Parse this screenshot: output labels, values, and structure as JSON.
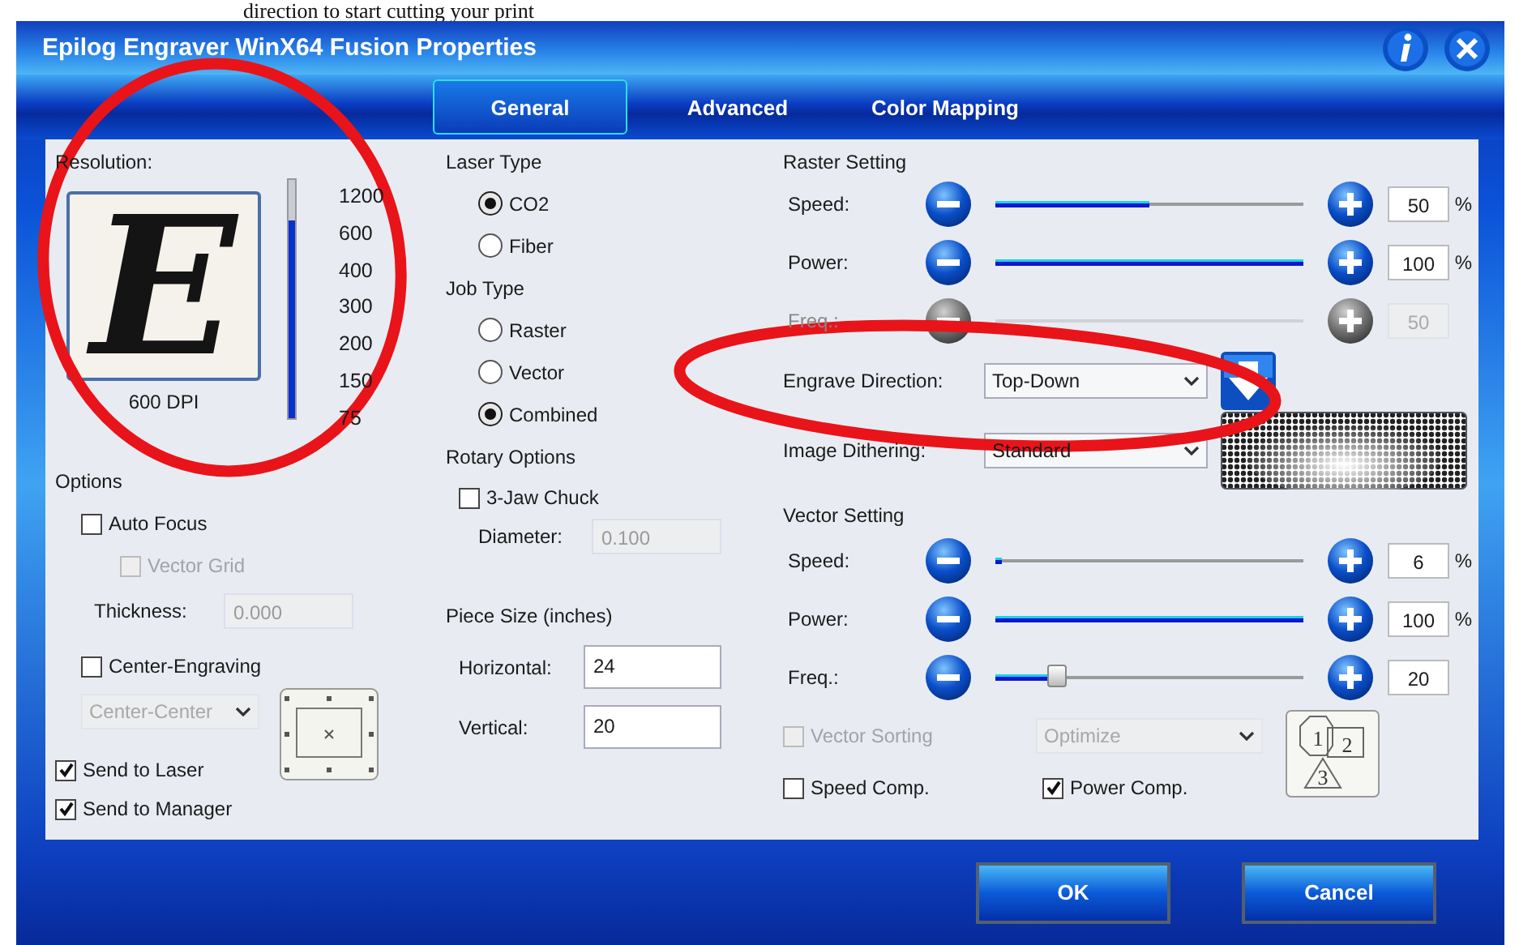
{
  "caption": "direction to start cutting your print",
  "window": {
    "title": "Epilog Engraver WinX64 Fusion Properties"
  },
  "tabs": [
    {
      "label": "General",
      "selected": true
    },
    {
      "label": "Advanced",
      "selected": false
    },
    {
      "label": "Color Mapping",
      "selected": false
    }
  ],
  "resolution": {
    "label": "Resolution:",
    "preview_letter": "E",
    "reading": "600 DPI",
    "level": 0.83,
    "ticks": [
      "1200",
      "600",
      "400",
      "300",
      "200",
      "150",
      "75"
    ]
  },
  "options": {
    "title": "Options",
    "auto_focus": {
      "label": "Auto Focus",
      "checked": false,
      "disabled": false
    },
    "vector_grid": {
      "label": "Vector Grid",
      "checked": false,
      "disabled": true
    },
    "thickness": {
      "label": "Thickness:",
      "value": "0.000",
      "disabled": true
    },
    "center_engraving": {
      "label": "Center-Engraving",
      "checked": false,
      "disabled": false
    },
    "center_position": {
      "value": "Center-Center",
      "disabled": true
    },
    "send_to_laser": {
      "label": "Send to Laser",
      "checked": true,
      "disabled": false
    },
    "send_to_manager": {
      "label": "Send to Manager",
      "checked": true,
      "disabled": false
    }
  },
  "laser_type": {
    "title": "Laser Type",
    "options": [
      {
        "label": "CO2",
        "selected": true
      },
      {
        "label": "Fiber",
        "selected": false
      }
    ]
  },
  "job_type": {
    "title": "Job Type",
    "options": [
      {
        "label": "Raster",
        "selected": false
      },
      {
        "label": "Vector",
        "selected": false
      },
      {
        "label": "Combined",
        "selected": true
      }
    ]
  },
  "rotary_options": {
    "title": "Rotary Options",
    "three_jaw_chuck": {
      "label": "3-Jaw Chuck",
      "checked": false,
      "disabled": false
    },
    "diameter": {
      "label": "Diameter:",
      "value": "0.100",
      "disabled": true
    }
  },
  "piece_size": {
    "title": "Piece Size (inches)",
    "fields": [
      {
        "label": "Horizontal:",
        "value": "24"
      },
      {
        "label": "Vertical:",
        "value": "20"
      }
    ]
  },
  "raster_setting": {
    "title": "Raster Setting",
    "sliders": [
      {
        "label": "Speed:",
        "handle": false,
        "level": 0.5,
        "value": "50",
        "unit": "%",
        "disabled": false
      },
      {
        "label": "Power:",
        "handle": false,
        "level": 1,
        "value": "100",
        "unit": "%",
        "disabled": false
      },
      {
        "label": "Freq.:",
        "handle": false,
        "value": "50",
        "disabled": true
      }
    ]
  },
  "engrave_direction": {
    "label": "Engrave Direction:",
    "value": "Top-Down"
  },
  "image_dithering": {
    "label": "Image Dithering:",
    "value": "Standard"
  },
  "vector_setting": {
    "title": "Vector Setting",
    "sliders": [
      {
        "label": "Speed:",
        "handle": false,
        "level": 0.02,
        "value": "6",
        "unit": "%",
        "disabled": false
      },
      {
        "label": "Power:",
        "handle": false,
        "level": 1,
        "value": "100",
        "unit": "%",
        "disabled": false
      },
      {
        "label": "Freq.:",
        "handle": true,
        "level": 0.2,
        "value": "20",
        "disabled": false
      }
    ]
  },
  "vector_sorting": {
    "label": "Vector Sorting",
    "checked": false,
    "disabled": true
  },
  "sort_method": {
    "value": "Optimize",
    "disabled": true
  },
  "sort_order_digits": [
    "1",
    "2",
    "3"
  ],
  "speed_comp": {
    "label": "Speed Comp.",
    "checked": false,
    "disabled": false
  },
  "power_comp": {
    "label": "Power Comp.",
    "checked": true,
    "disabled": false
  },
  "buttons": [
    "OK",
    "Cancel"
  ]
}
